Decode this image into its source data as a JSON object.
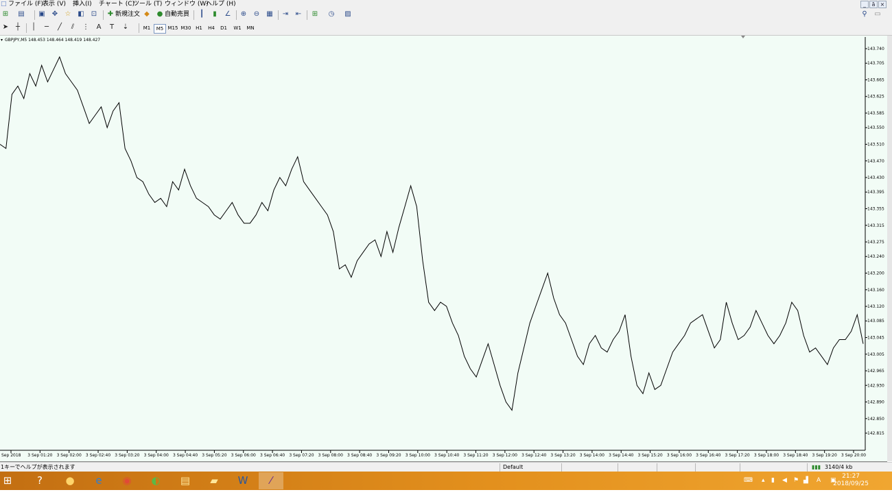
{
  "menu": [
    "ファイル (F)",
    "表示 (V)",
    "挿入(I)",
    "チャート (C)",
    "ツール (T)",
    "ウィンドウ (W)",
    "ヘルプ (H)"
  ],
  "window_controls": [
    "_",
    "ā",
    "×"
  ],
  "toolbar": {
    "new_order_label": "新規注文",
    "autotrade_label": "自動売買"
  },
  "timeframes": [
    "M1",
    "M5",
    "M15",
    "M30",
    "H1",
    "H4",
    "D1",
    "W1",
    "MN"
  ],
  "active_timeframe": "M5",
  "chart_header": "GBPJPY,M5  148.453 148.464 148.419 148.427",
  "chart_data": {
    "type": "line",
    "symbol": "GBPJPY",
    "timeframe": "M5",
    "y_ticks": [
      "143.740",
      "143.705",
      "143.665",
      "143.625",
      "143.585",
      "143.550",
      "143.510",
      "143.470",
      "143.430",
      "143.395",
      "143.355",
      "143.315",
      "143.275",
      "143.240",
      "143.200",
      "143.160",
      "143.120",
      "143.085",
      "143.045",
      "143.005",
      "142.965",
      "142.930",
      "142.890",
      "142.850",
      "142.815"
    ],
    "x_ticks": [
      "Sep 2018",
      "3 Sep 01:20",
      "3 Sep 02:00",
      "3 Sep 02:40",
      "3 Sep 03:20",
      "3 Sep 04:00",
      "3 Sep 04:40",
      "3 Sep 05:20",
      "3 Sep 06:00",
      "3 Sep 06:40",
      "3 Sep 07:20",
      "3 Sep 08:00",
      "3 Sep 08:40",
      "3 Sep 09:20",
      "3 Sep 10:00",
      "3 Sep 10:40",
      "3 Sep 11:20",
      "3 Sep 12:00",
      "3 Sep 12:40",
      "3 Sep 13:20",
      "3 Sep 14:00",
      "3 Sep 14:40",
      "3 Sep 15:20",
      "3 Sep 16:00",
      "3 Sep 16:40",
      "3 Sep 17:20",
      "3 Sep 18:00",
      "3 Sep 18:40",
      "3 Sep 19:20",
      "3 Sep 20:00"
    ],
    "ylim": [
      142.815,
      143.74
    ],
    "values": [
      143.51,
      143.5,
      143.63,
      143.65,
      143.62,
      143.68,
      143.65,
      143.7,
      143.66,
      143.69,
      143.72,
      143.68,
      143.66,
      143.64,
      143.6,
      143.56,
      143.58,
      143.6,
      143.55,
      143.59,
      143.61,
      143.5,
      143.47,
      143.43,
      143.42,
      143.39,
      143.37,
      143.38,
      143.36,
      143.42,
      143.4,
      143.45,
      143.41,
      143.38,
      143.37,
      143.36,
      143.34,
      143.33,
      143.35,
      143.37,
      143.34,
      143.32,
      143.32,
      143.34,
      143.37,
      143.35,
      143.4,
      143.43,
      143.41,
      143.45,
      143.48,
      143.42,
      143.4,
      143.38,
      143.36,
      143.34,
      143.3,
      143.21,
      143.22,
      143.19,
      143.23,
      143.25,
      143.27,
      143.28,
      143.24,
      143.3,
      143.25,
      143.31,
      143.36,
      143.41,
      143.36,
      143.23,
      143.13,
      143.11,
      143.13,
      143.12,
      143.08,
      143.05,
      143.0,
      142.97,
      142.95,
      142.99,
      143.03,
      142.98,
      142.93,
      142.89,
      142.87,
      142.96,
      143.02,
      143.08,
      143.12,
      143.16,
      143.2,
      143.14,
      143.1,
      143.08,
      143.04,
      143.0,
      142.98,
      143.03,
      143.05,
      143.02,
      143.01,
      143.04,
      143.06,
      143.1,
      143.0,
      142.93,
      142.91,
      142.96,
      142.92,
      142.93,
      142.97,
      143.01,
      143.03,
      143.05,
      143.08,
      143.09,
      143.1,
      143.06,
      143.02,
      143.04,
      143.13,
      143.08,
      143.04,
      143.05,
      143.07,
      143.11,
      143.08,
      143.05,
      143.03,
      143.05,
      143.08,
      143.13,
      143.11,
      143.05,
      143.01,
      143.02,
      143.0,
      142.98,
      143.02,
      143.04,
      143.04,
      143.06,
      143.1,
      143.03
    ],
    "line_color": "#000000",
    "background": "#f2fcf6",
    "grid": false
  },
  "status": {
    "help_text": "1キーでヘルプが表示されます",
    "profile": "Default",
    "connection": "3140/4 kb"
  },
  "taskbar": {
    "apps": [
      "windows-start",
      "help-app",
      "firefox-app",
      "ie-app",
      "chrome-app",
      "green-app",
      "file-explorer-app",
      "folder-app",
      "word-app",
      "metatrader-app"
    ],
    "clock_time": "21:27",
    "clock_date": "2018/09/25",
    "ime_label": "A"
  }
}
